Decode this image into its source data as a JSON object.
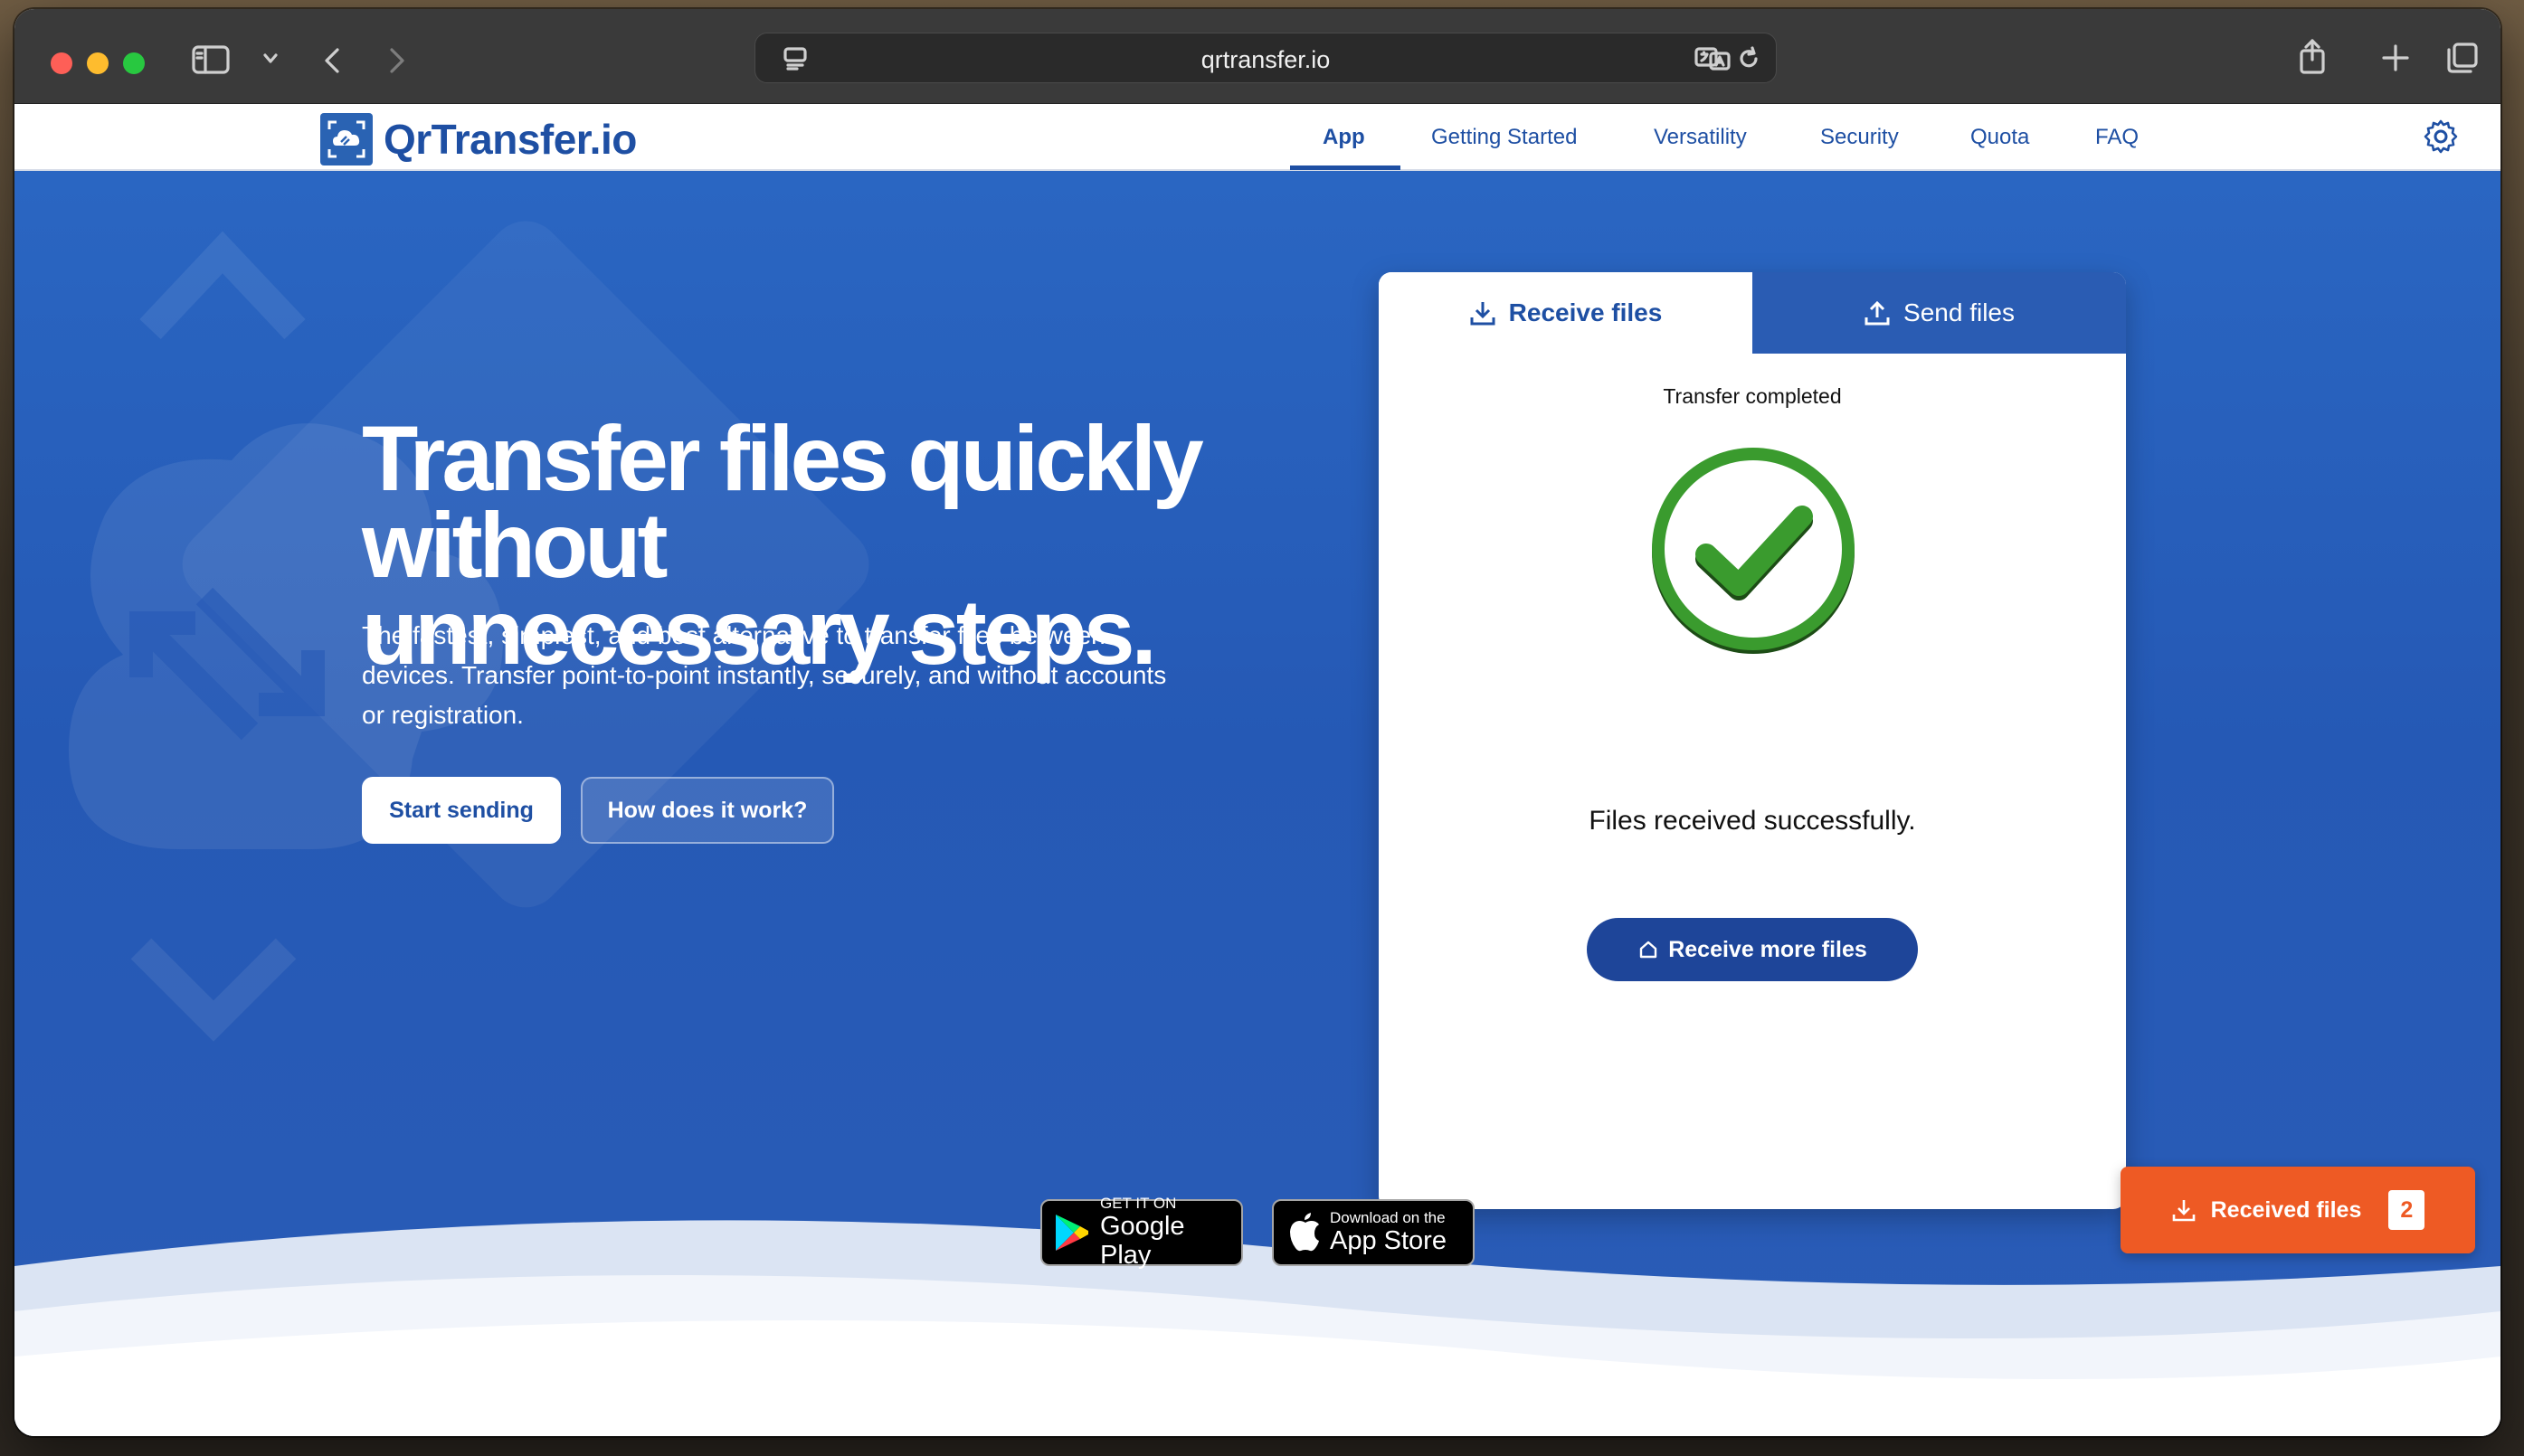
{
  "browser": {
    "url": "qrtransfer.io"
  },
  "nav": {
    "logo_text": "QrTransfer.io",
    "items": [
      {
        "label": "App",
        "active": true
      },
      {
        "label": "Getting Started",
        "active": false
      },
      {
        "label": "Versatility",
        "active": false
      },
      {
        "label": "Security",
        "active": false
      },
      {
        "label": "Quota",
        "active": false
      },
      {
        "label": "FAQ",
        "active": false
      }
    ]
  },
  "hero": {
    "headline_line1": "Transfer files quickly without",
    "headline_line2": "unnecessary steps.",
    "subtext_line1": "The fastest, simplest, and best alternative to transfer files between",
    "subtext_line2": "devices. Transfer point-to-point instantly, securely, and without accounts",
    "subtext_line3": "or registration.",
    "start_label": "Start sending",
    "how_label": "How does it work?"
  },
  "card": {
    "tab_receive": "Receive files",
    "tab_send": "Send files",
    "active_tab": "receive",
    "status": "Transfer completed",
    "success": "Files received successfully.",
    "more_label": "Receive more files"
  },
  "stores": {
    "google_small": "GET IT ON",
    "google_big": "Google Play",
    "apple_small": "Download on the",
    "apple_big": "App Store"
  },
  "received": {
    "label": "Received files",
    "count": "2"
  },
  "colors": {
    "brand_blue": "#1e4fa3",
    "hero_blue": "#2a62bf",
    "accent_orange": "#ee5a24",
    "success_green": "#3a9b2e"
  }
}
